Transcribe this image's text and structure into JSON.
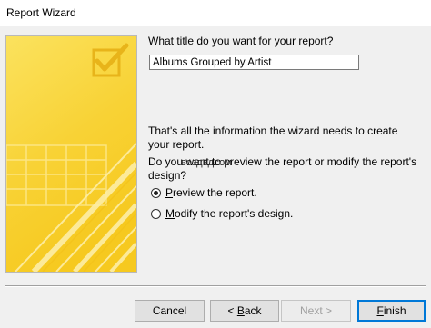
{
  "window": {
    "title": "Report Wizard"
  },
  "prompt": {
    "title_question": "What title do you want for your report?",
    "title_value": "Albums Grouped by Artist",
    "info_text": "That's all the information the wizard needs to create your report.",
    "question": "Do you want to preview the report or modify the report's design?"
  },
  "options": [
    {
      "label_prefix": "",
      "label_mnemonic": "P",
      "label_rest": "review the report.",
      "selected": true
    },
    {
      "label_prefix": "",
      "label_mnemonic": "M",
      "label_rest": "odify the report's design.",
      "selected": false
    }
  ],
  "watermark": "воздвдсом",
  "buttons": {
    "cancel": "Cancel",
    "back_prefix": "< ",
    "back_mnemonic": "B",
    "back_rest": "ack",
    "next": "Next >",
    "finish_mnemonic": "F",
    "finish_rest": "inish"
  },
  "colors": {
    "art_yellow": "#f9d43a",
    "art_light": "#fde888",
    "accent_button": "#0078d7"
  }
}
